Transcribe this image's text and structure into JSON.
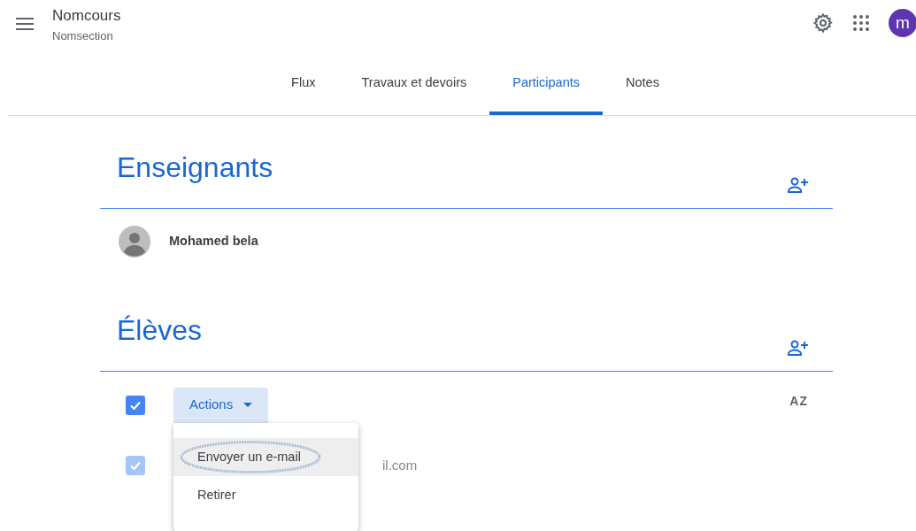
{
  "header": {
    "course": "Nomcours",
    "section": "Nomsection",
    "avatar": "m"
  },
  "tabs": [
    {
      "label": "Flux",
      "selected": false
    },
    {
      "label": "Travaux et devoirs",
      "selected": false
    },
    {
      "label": "Participants",
      "selected": true
    },
    {
      "label": "Notes",
      "selected": false
    }
  ],
  "teachers": {
    "title": "Enseignants",
    "people": [
      {
        "name": "Mohamed bela"
      }
    ]
  },
  "students": {
    "title": "Élèves",
    "select_all_checked": true,
    "actions_label": "Actions",
    "sort_label": "AZ",
    "rows": [
      {
        "email": "il.com",
        "checked": true
      }
    ],
    "menu": {
      "items": [
        {
          "label": "Envoyer un e-mail",
          "hovered": true,
          "circled": true
        },
        {
          "label": "Retirer",
          "hovered": false,
          "circled": false
        }
      ]
    }
  }
}
